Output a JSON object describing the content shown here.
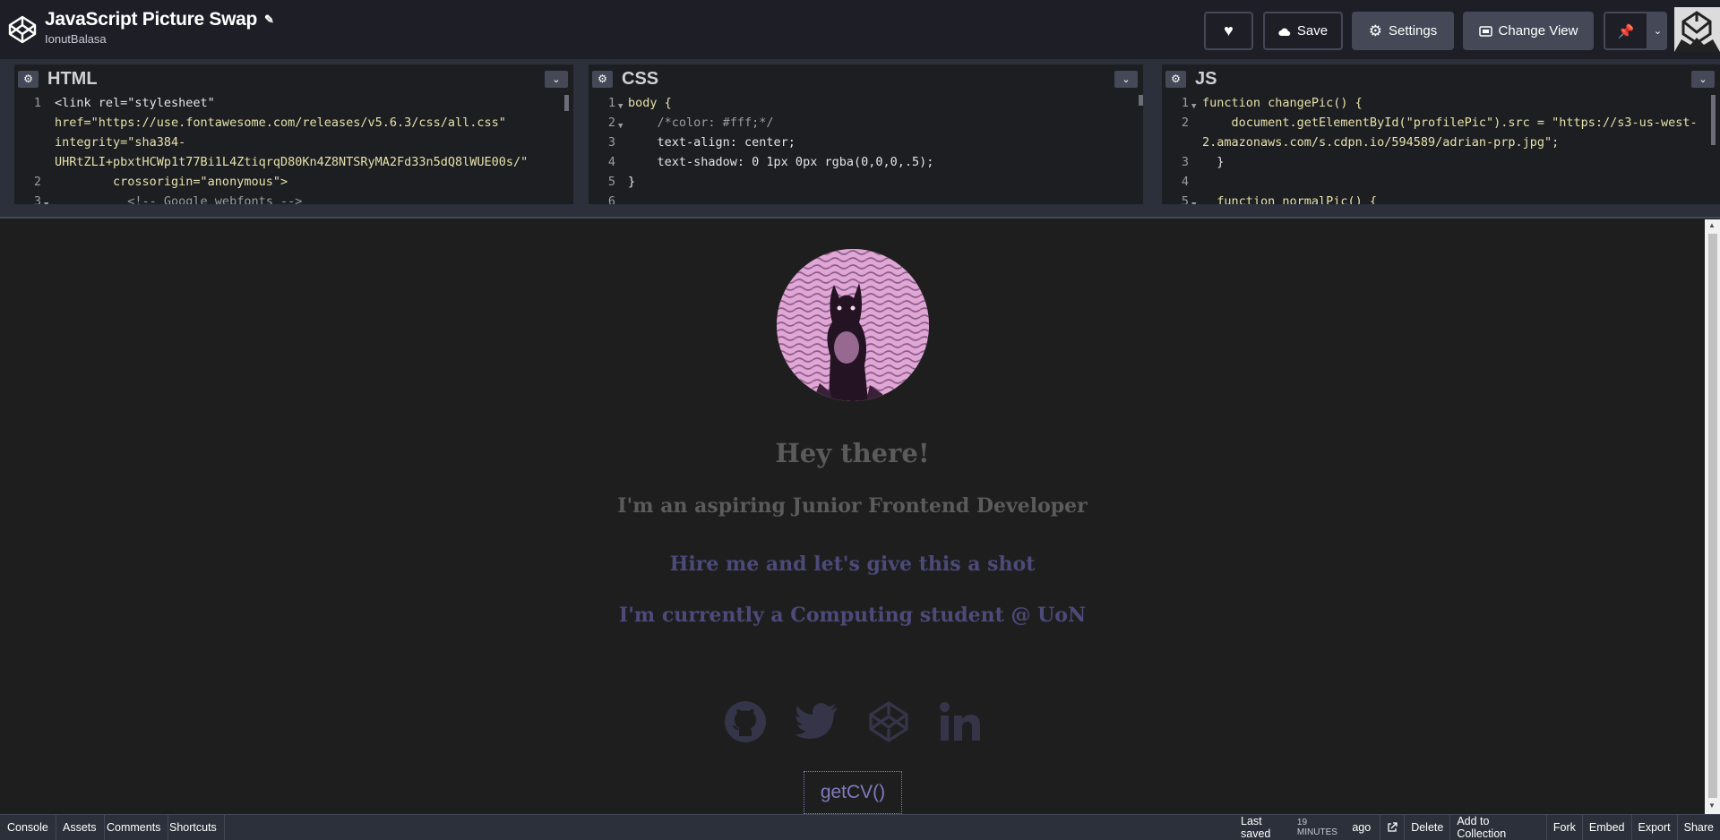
{
  "header": {
    "title": "JavaScript Picture Swap",
    "author": "IonutBalasa",
    "save_label": "Save",
    "settings_label": "Settings",
    "change_view_label": "Change View"
  },
  "editors": {
    "html": {
      "title": "HTML",
      "lines": [
        {
          "num": "1",
          "text": "<link rel=\"stylesheet\""
        },
        {
          "num": "",
          "text": "href=\"https://use.fontawesome.com/releases/v5.6.3/css/all.css\""
        },
        {
          "num": "",
          "text": "integrity=\"sha384-"
        },
        {
          "num": "",
          "text": "UHRtZLI+pbxtHCWp1t77Bi1L4ZtiqrqD80Kn4Z8NTSRyMA2Fd33n5dQ8lWUE00s/\""
        },
        {
          "num": "2",
          "text": "        crossorigin=\"anonymous\">"
        },
        {
          "num": "3",
          "text": "          <!-- Google webfonts -->"
        }
      ]
    },
    "css": {
      "title": "CSS",
      "lines": [
        {
          "num": "1",
          "text": "body {"
        },
        {
          "num": "2",
          "text": "    /*color: #fff;*/"
        },
        {
          "num": "3",
          "text": "    text-align: center;"
        },
        {
          "num": "4",
          "text": "    text-shadow: 0 1px 0px rgba(0,0,0,.5);"
        },
        {
          "num": "5",
          "text": "}"
        },
        {
          "num": "6",
          "text": ""
        }
      ]
    },
    "js": {
      "title": "JS",
      "lines": [
        {
          "num": "1",
          "text": "function changePic() {"
        },
        {
          "num": "2",
          "text": "    document.getElementById(\"profilePic\").src = \"https://s3-us-west-"
        },
        {
          "num": "",
          "text": "2.amazonaws.com/s.cdpn.io/594589/adrian-prp.jpg\";"
        },
        {
          "num": "3",
          "text": "  }"
        },
        {
          "num": "4",
          "text": ""
        },
        {
          "num": "5",
          "text": "  function normalPic() {"
        }
      ]
    }
  },
  "preview": {
    "heading": "Hey there!",
    "line1": "I'm an aspiring Junior Frontend Developer",
    "line2": "Hire me and let's give this a shot",
    "line3": "I'm currently a Computing student @ UoN",
    "cv_button": "getCV()",
    "colors": {
      "heading": "#5b5b5b",
      "line1": "#5b5b5b",
      "accent": "#4d4a7a",
      "button": "#7f7ac0"
    }
  },
  "footer": {
    "left": [
      "Console",
      "Assets",
      "Comments",
      "Shortcuts"
    ],
    "last_saved_prefix": "Last saved",
    "last_saved_time": "19 MINUTES",
    "last_saved_suffix": "ago",
    "right": [
      "Delete",
      "Add to Collection",
      "Fork",
      "Embed",
      "Export",
      "Share"
    ]
  }
}
